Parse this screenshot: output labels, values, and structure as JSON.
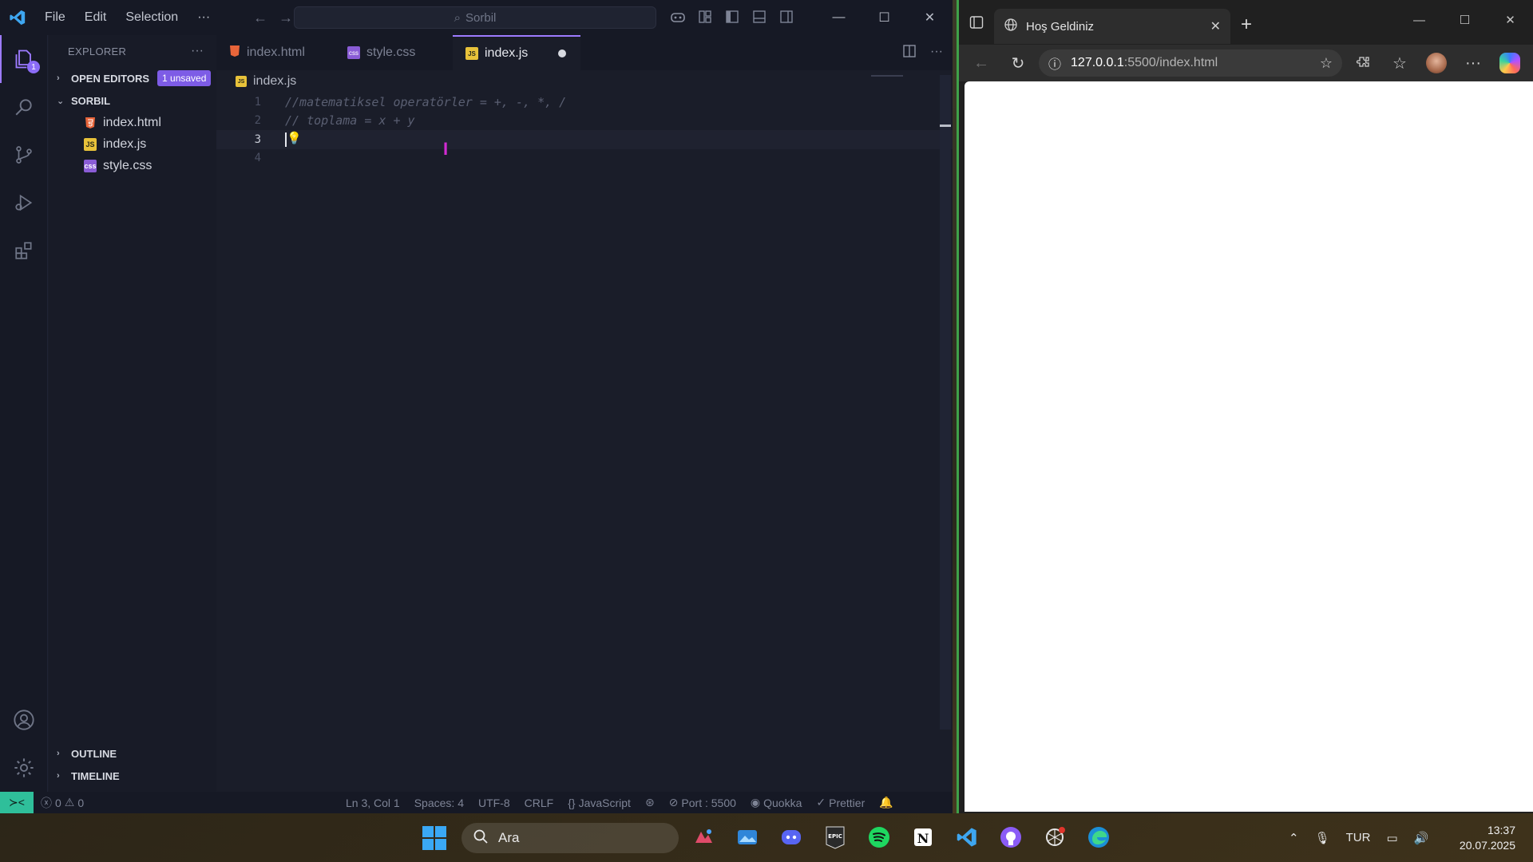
{
  "vscode": {
    "menu": [
      "File",
      "Edit",
      "Selection",
      "···"
    ],
    "search_text": "Sorbil",
    "activity_badge": "1",
    "explorer_title": "EXPLORER",
    "open_editors_label": "OPEN EDITORS",
    "unsaved_badge": "1 unsaved",
    "folder_label": "SORBIL",
    "files": [
      {
        "name": "index.html",
        "type": "html"
      },
      {
        "name": "index.js",
        "type": "js"
      },
      {
        "name": "style.css",
        "type": "css"
      }
    ],
    "outline_label": "OUTLINE",
    "timeline_label": "TIMELINE",
    "tabs": [
      {
        "label": "index.html",
        "type": "html"
      },
      {
        "label": "style.css",
        "type": "css"
      },
      {
        "label": "index.js",
        "type": "js"
      }
    ],
    "breadcrumb": "index.js",
    "code_lines": [
      {
        "n": "1",
        "text": "//matematiksel operatörler = +, -, *, /"
      },
      {
        "n": "2",
        "text": "// toplama = x + y"
      },
      {
        "n": "3",
        "text": ""
      },
      {
        "n": "4",
        "text": ""
      }
    ],
    "status": {
      "errors": "0",
      "warnings": "0",
      "position": "Ln 3, Col 1",
      "spaces": "Spaces: 4",
      "encoding": "UTF-8",
      "eol": "CRLF",
      "language": "JavaScript",
      "port": "Port : 5500",
      "quokka": "Quokka",
      "prettier": "Prettier"
    },
    "colors": {
      "accent": "#9d7bff",
      "remote": "#2fbf9a",
      "background": "#1a1d29"
    }
  },
  "browser": {
    "tab_title": "Hoş Geldiniz",
    "url_host": "127.0.0.1",
    "url_path": ":5500/index.html"
  },
  "taskbar": {
    "search_placeholder": "Ara",
    "apps": [
      "photo-editor-icon",
      "photos-icon",
      "discord-icon",
      "epic-games-icon",
      "spotify-icon",
      "notion-icon",
      "vscode-icon",
      "github-icon",
      "chatgpt-icon",
      "edge-icon"
    ],
    "language": "TUR",
    "time": "13:37",
    "date": "20.07.2025"
  }
}
